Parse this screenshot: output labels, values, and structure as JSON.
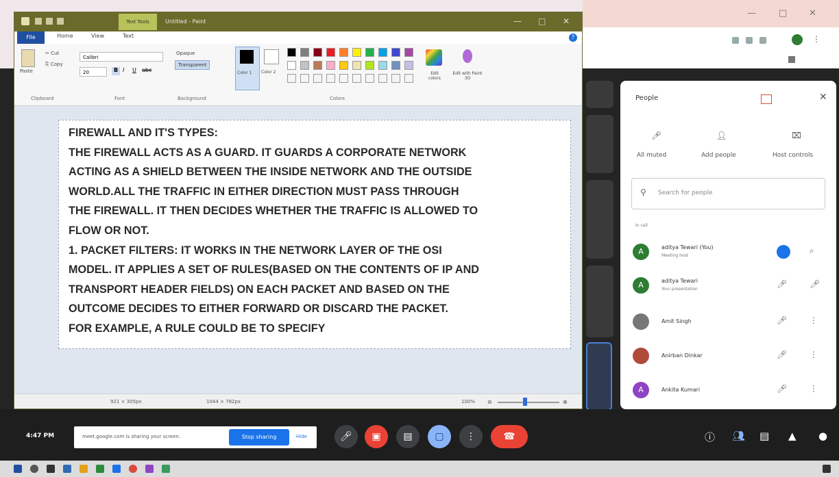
{
  "paint": {
    "title_badge": "Text Tools",
    "title": "Untitled - Paint",
    "tabs": [
      "File",
      "Home",
      "View",
      "Text"
    ],
    "ribbon": {
      "paste": "Paste",
      "cut": "Cut",
      "copy": "Copy",
      "font_name": "Calibri",
      "font_size": "20",
      "opaque": "Opaque",
      "transparent": "Transparent",
      "color1": "Color 1",
      "color2": "Color 2",
      "edit_colors": "Edit colors",
      "edit_paint3d": "Edit with Paint 3D",
      "groups": [
        "Clipboard",
        "Font",
        "Background",
        "Colors"
      ]
    },
    "document_lines": [
      "FIREWALL AND IT'S TYPES:",
      "THE FIREWALL ACTS AS A GUARD. IT GUARDS A CORPORATE NETWORK",
      "ACTING AS A SHIELD BETWEEN THE INSIDE NETWORK AND THE OUTSIDE",
      "WORLD.ALL THE TRAFFIC IN EITHER DIRECTION MUST PASS THROUGH",
      "THE FIREWALL. IT THEN DECIDES WHETHER THE TRAFFIC IS ALLOWED TO",
      "FLOW OR NOT.",
      "1. PACKET FILTERS: IT WORKS IN THE NETWORK LAYER OF THE OSI",
      "MODEL. IT APPLIES A SET OF RULES(BASED ON THE CONTENTS OF IP AND",
      "TRANSPORT HEADER FIELDS) ON EACH PACKET AND BASED ON  THE",
      "OUTCOME DECIDES TO EITHER FORWARD OR DISCARD THE PACKET.",
      "FOR EXAMPLE, A RULE COULD BE TO SPECIFY"
    ],
    "status": {
      "cursor_pos": "921 × 305px",
      "image_size": "1044 × 782px",
      "zoom": "100%"
    }
  },
  "people_panel": {
    "title": "People",
    "actions": [
      "All muted",
      "Add people",
      "Host controls"
    ],
    "search_placeholder": "Search for people",
    "section": "In call",
    "participants": [
      {
        "initial": "A",
        "name": "aditya Tewari (You)",
        "sub": "Meeting host",
        "color": "#2e7d32"
      },
      {
        "initial": "A",
        "name": "aditya Tewari",
        "sub": "Your presentation",
        "color": "#2e7d32"
      },
      {
        "initial": "",
        "name": "Amit Singh",
        "sub": "",
        "color": "#777777"
      },
      {
        "initial": "",
        "name": "Anirban Dinkar",
        "sub": "",
        "color": "#b04a3a"
      },
      {
        "initial": "A",
        "name": "Ankita Kumari",
        "sub": "",
        "color": "#8e44c4"
      }
    ]
  },
  "meet_bar": {
    "time": "4:47 PM",
    "share_msg": "meet.google.com is sharing your screen.",
    "stop_sharing": "Stop sharing",
    "hide": "Hide"
  },
  "colors": {
    "paint_title": "#6a6a2a",
    "meet_dark": "#242424",
    "hangup_red": "#ea4335",
    "accent_blue": "#1a73e8"
  }
}
